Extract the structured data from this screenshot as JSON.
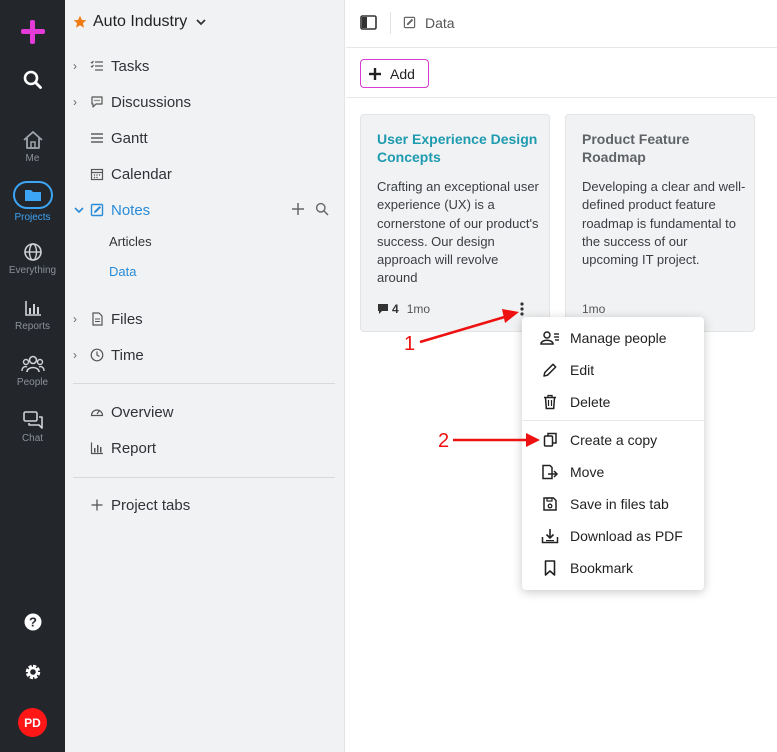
{
  "rail": {
    "items": [
      {
        "label": "Me",
        "icon": "home-icon"
      },
      {
        "label": "Projects",
        "icon": "folder-icon"
      },
      {
        "label": "Everything",
        "icon": "globe-icon"
      },
      {
        "label": "Reports",
        "icon": "bar-chart-icon"
      },
      {
        "label": "People",
        "icon": "people-icon"
      },
      {
        "label": "Chat",
        "icon": "chat-icon"
      }
    ],
    "avatar": "PD",
    "brand_color": "#e23bd8",
    "accent_color": "#3da5f5"
  },
  "sidebar": {
    "project": "Auto Industry",
    "items": [
      {
        "label": "Tasks"
      },
      {
        "label": "Discussions"
      },
      {
        "label": "Gantt"
      },
      {
        "label": "Calendar"
      },
      {
        "label": "Notes"
      },
      {
        "label": "Files"
      },
      {
        "label": "Time"
      },
      {
        "label": "Overview"
      },
      {
        "label": "Report"
      },
      {
        "label": "Project tabs"
      }
    ],
    "notes_sub": [
      {
        "label": "Articles"
      },
      {
        "label": "Data"
      }
    ]
  },
  "topbar": {
    "breadcrumb": "Data"
  },
  "toolbar": {
    "add_label": "Add"
  },
  "cards": [
    {
      "title": "User Experience Design Concepts",
      "text": "Crafting an exceptional user experience (UX) is a cornerstone of our product's success. Our design approach will revolve around",
      "comments": "4",
      "age": "1mo",
      "title_color": "#1e9bb0"
    },
    {
      "title": "Product Feature Roadmap",
      "text": "Developing a clear and well-defined product feature roadmap is fundamental to the success of our upcoming IT project.",
      "age": "1mo",
      "title_color": "#5f6368"
    }
  ],
  "menu": {
    "items": [
      {
        "label": "Manage people",
        "icon": "manage-people-icon"
      },
      {
        "label": "Edit",
        "icon": "pencil-icon"
      },
      {
        "label": "Delete",
        "icon": "trash-icon"
      },
      {
        "label": "Create a copy",
        "icon": "copy-icon"
      },
      {
        "label": "Move",
        "icon": "move-icon"
      },
      {
        "label": "Save in files tab",
        "icon": "save-icon"
      },
      {
        "label": "Download as PDF",
        "icon": "download-icon"
      },
      {
        "label": "Bookmark",
        "icon": "bookmark-icon"
      }
    ]
  },
  "annotations": {
    "one": "1",
    "two": "2",
    "color": "#ee1111"
  }
}
